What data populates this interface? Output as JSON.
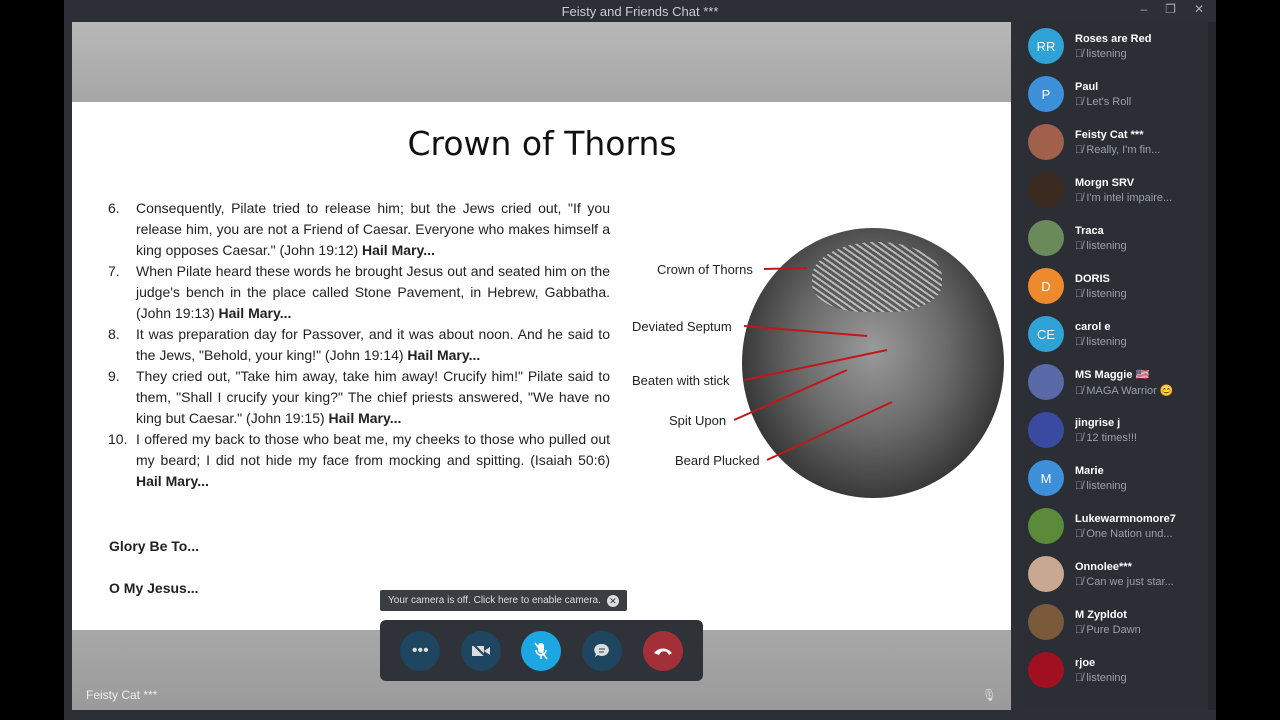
{
  "window": {
    "title": "Feisty and Friends Chat ***"
  },
  "slide": {
    "title": "Crown of Thorns",
    "items": [
      {
        "n": "6.",
        "text": "Consequently, Pilate tried to release him; but the Jews cried out, \"If you release him, you are not a Friend of Caesar. Everyone who makes himself a king opposes Caesar.\" (John 19:12)",
        "bold": "Hail Mary..."
      },
      {
        "n": "7.",
        "text": "When Pilate heard these words he brought Jesus out and seated him on the judge's bench in the place called Stone Pavement, in Hebrew, Gabbatha. (John 19:13)",
        "bold": "Hail Mary..."
      },
      {
        "n": "8.",
        "text": "It was preparation day for Passover, and it was about noon. And he said to the Jews, \"Behold, your king!\" (John 19:14)",
        "bold": "Hail Mary..."
      },
      {
        "n": "9.",
        "text": "They cried out, \"Take him away, take him away! Crucify him!\" Pilate said to them, \"Shall I crucify your king?\" The chief priests answered, \"We have no king but Caesar.\" (John 19:15)",
        "bold": "Hail Mary..."
      },
      {
        "n": "10.",
        "text": "I offered my back to those who beat me, my cheeks to those who pulled out my beard; I did not hide my face from mocking and spitting. (Isaiah 50:6)",
        "bold": "Hail Mary..."
      }
    ],
    "glory": "Glory Be To...",
    "omy": "O My Jesus...",
    "labels": [
      "Crown of Thorns",
      "Deviated Septum",
      "Beaten with stick",
      "Spit Upon",
      "Beard Plucked"
    ]
  },
  "self_name": "Feisty Cat ***",
  "tooltip": "Your camera is off. Click here to enable camera.",
  "controls": {
    "more": "•••",
    "accent": "#1ca7e3",
    "end_color": "#a33038"
  },
  "participants": [
    {
      "name": "Roses are Red",
      "status": "listening",
      "initials": "RR",
      "color": "#2fa3d6"
    },
    {
      "name": "Paul",
      "status": "Let's Roll",
      "initials": "P",
      "color": "#3d8fd9"
    },
    {
      "name": "Feisty Cat ***",
      "status": "Really, I'm fin...",
      "initials": "",
      "color": "#a0604c"
    },
    {
      "name": "Morgn SRV",
      "status": "I'm intel impaire...",
      "initials": "",
      "color": "#3a2a20"
    },
    {
      "name": "Traca",
      "status": "listening",
      "initials": "",
      "color": "#6b8a5a"
    },
    {
      "name": "DORIS",
      "status": "listening",
      "initials": "D",
      "color": "#ee8a2c"
    },
    {
      "name": "carol e",
      "status": "listening",
      "initials": "CE",
      "color": "#2fa3d6"
    },
    {
      "name": "MS Maggie 🇺🇸",
      "status": "MAGA Warrior 😊",
      "initials": "",
      "color": "#5a6aa8"
    },
    {
      "name": "jingrise j",
      "status": "12 times!!!",
      "initials": "",
      "color": "#3a4aa0"
    },
    {
      "name": "Marie",
      "status": "listening",
      "initials": "M",
      "color": "#3d8fd9"
    },
    {
      "name": "Lukewarmnomore7",
      "status": "One Nation und...",
      "initials": "",
      "color": "#5a8a3a"
    },
    {
      "name": "Onnolee***",
      "status": "Can we just star...",
      "initials": "",
      "color": "#c8a890"
    },
    {
      "name": "M Zypldot",
      "status": "Pure Dawn",
      "initials": "",
      "color": "#7a5a3a"
    },
    {
      "name": "rjoe",
      "status": "listening",
      "initials": "",
      "color": "#a01020"
    }
  ]
}
